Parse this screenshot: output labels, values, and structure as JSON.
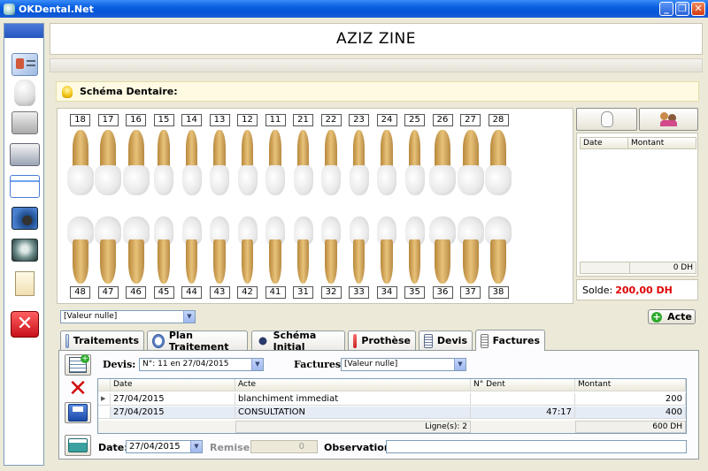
{
  "window": {
    "title": "OKDental.Net",
    "min": "_",
    "max": "❐",
    "close": "✕"
  },
  "sidebar": {
    "items": [
      {
        "name": "patient-card-icon"
      },
      {
        "name": "tooth-icon"
      },
      {
        "name": "cabinet-icon"
      },
      {
        "name": "cash-register-icon"
      },
      {
        "name": "calendar-window-icon"
      },
      {
        "name": "camera-icon"
      },
      {
        "name": "xray-icon"
      },
      {
        "name": "document-icon"
      },
      {
        "name": "exit-icon"
      }
    ]
  },
  "header": {
    "patient_name": "AZIZ ZINE"
  },
  "schema": {
    "label": "Schéma Dentaire:"
  },
  "teeth": {
    "upper": [
      "18",
      "17",
      "16",
      "15",
      "14",
      "13",
      "12",
      "11",
      "21",
      "22",
      "23",
      "24",
      "25",
      "26",
      "27",
      "28"
    ],
    "lower": [
      "48",
      "47",
      "46",
      "45",
      "44",
      "43",
      "42",
      "41",
      "31",
      "32",
      "33",
      "34",
      "35",
      "36",
      "37",
      "38"
    ]
  },
  "right_panel": {
    "col_date": "Date",
    "col_montant": "Montant",
    "total": "0 DH",
    "solde_label": "Solde:",
    "solde_value": "200,00 DH"
  },
  "combo_acte": {
    "value": "[Valeur nulle]"
  },
  "acte_button": {
    "label": "Acte"
  },
  "tabs": [
    {
      "label": "Traitements"
    },
    {
      "label": "Plan Traitement"
    },
    {
      "label": "Schéma Initial"
    },
    {
      "label": "Prothèse"
    },
    {
      "label": "Devis"
    },
    {
      "label": "Factures"
    }
  ],
  "factures": {
    "devis_label": "Devis:",
    "devis_value": "N°: 11 en 27/04/2015",
    "factures_label": "Factures:",
    "factures_value": "[Valeur nulle]",
    "columns": [
      "Date",
      "Acte",
      "N° Dent",
      "Montant"
    ],
    "rows": [
      {
        "date": "27/04/2015",
        "acte": "blanchiment immediat",
        "dent": "",
        "montant": "200"
      },
      {
        "date": "27/04/2015",
        "acte": "CONSULTATION",
        "dent": "47:17",
        "montant": "400"
      }
    ],
    "row_count": "Ligne(s): 2",
    "total": "600 DH",
    "date_label": "Date:",
    "date_value": "27/04/2015",
    "remise_label": "Remise:",
    "remise_value": "0",
    "observation_label": "Observation:"
  },
  "colors": {
    "solde": "#e00000",
    "titlebar": "#0a5fe0"
  }
}
